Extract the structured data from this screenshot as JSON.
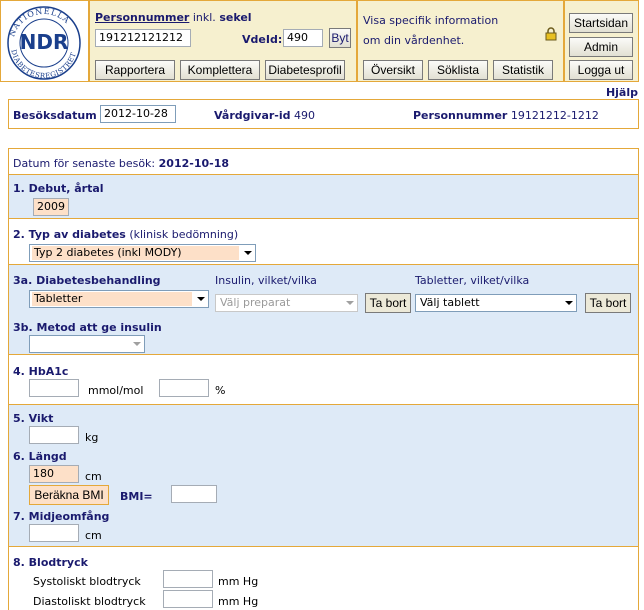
{
  "logo": {
    "arc_text": "NATIONELLA DIABETESREGISTRET",
    "center_text": "NDR"
  },
  "header": {
    "personnummer_label_bold": "Personnummer",
    "personnummer_label_rest": " inkl. ",
    "personnummer_label_sekel": "sekel",
    "personnummer_value": "191212121212",
    "vdeid_label": "VdeId:",
    "vdeid_value": "490",
    "byt_label": "Byt",
    "tabs": [
      "Rapportera",
      "Komplettera",
      "Diabetesprofil"
    ],
    "info_line1": "Visa specifik information",
    "info_line2": "om din vårdenhet.",
    "info_buttons": [
      "Översikt",
      "Söklista",
      "Statistik"
    ],
    "right_buttons": [
      "Startsidan",
      "Admin",
      "Logga ut"
    ],
    "help_link": "Hjälp"
  },
  "visit_bar": {
    "date_label": "Besöksdatum",
    "date_value": "2012-10-28",
    "provider_label": "Vårdgivar-id",
    "provider_value": "490",
    "pnr_label": "Personnummer",
    "pnr_value": "19121212-1212"
  },
  "last_visit": {
    "label": "Datum för senaste besök:",
    "value": "2012-10-18"
  },
  "sections": {
    "debut": {
      "label": "1. Debut, årtal",
      "value": "2009"
    },
    "diabetes_type": {
      "label_bold": "2. Typ av diabetes",
      "label_rest": " (klinisk bedömning)",
      "value": "Typ 2 diabetes (inkl MODY)"
    },
    "treatment": {
      "label": "3a. Diabetesbehandling",
      "value": "Tabletter",
      "insulin_label": "Insulin, vilket/vilka",
      "insulin_placeholder": "Välj preparat",
      "remove_label": "Ta bort",
      "tablets_label": "Tabletter, vilket/vilka",
      "tablets_placeholder": "Välj tablett",
      "remove_label_2": "Ta bort"
    },
    "insulin_method": {
      "label": "3b. Metod att ge insulin",
      "value": ""
    },
    "hba1c": {
      "label": "4. HbA1c",
      "unit1": "mmol/mol",
      "unit2": "%",
      "value1": "",
      "value2": ""
    },
    "weight": {
      "label": "5. Vikt",
      "unit": "kg",
      "value": ""
    },
    "height": {
      "label": "6. Längd",
      "unit": "cm",
      "value": "180",
      "bmi_button": "Beräkna BMI",
      "bmi_label": "BMI=",
      "bmi_value": ""
    },
    "waist": {
      "label": "7. Midjeomfång",
      "unit": "cm",
      "value": ""
    },
    "blood_pressure": {
      "label": "8. Blodtryck",
      "systolic_label": "Systoliskt blodtryck",
      "diastolic_label": "Diastoliskt blodtryck",
      "unit": "mm Hg",
      "systolic_value": "",
      "diastolic_value": ""
    }
  },
  "colors": {
    "border_orange": "#e4a83a",
    "header_bg": "#f6f0cf",
    "section_blue": "#deeaf7",
    "field_peach": "#fde0c8",
    "text_navy": "#1a1a6e"
  }
}
